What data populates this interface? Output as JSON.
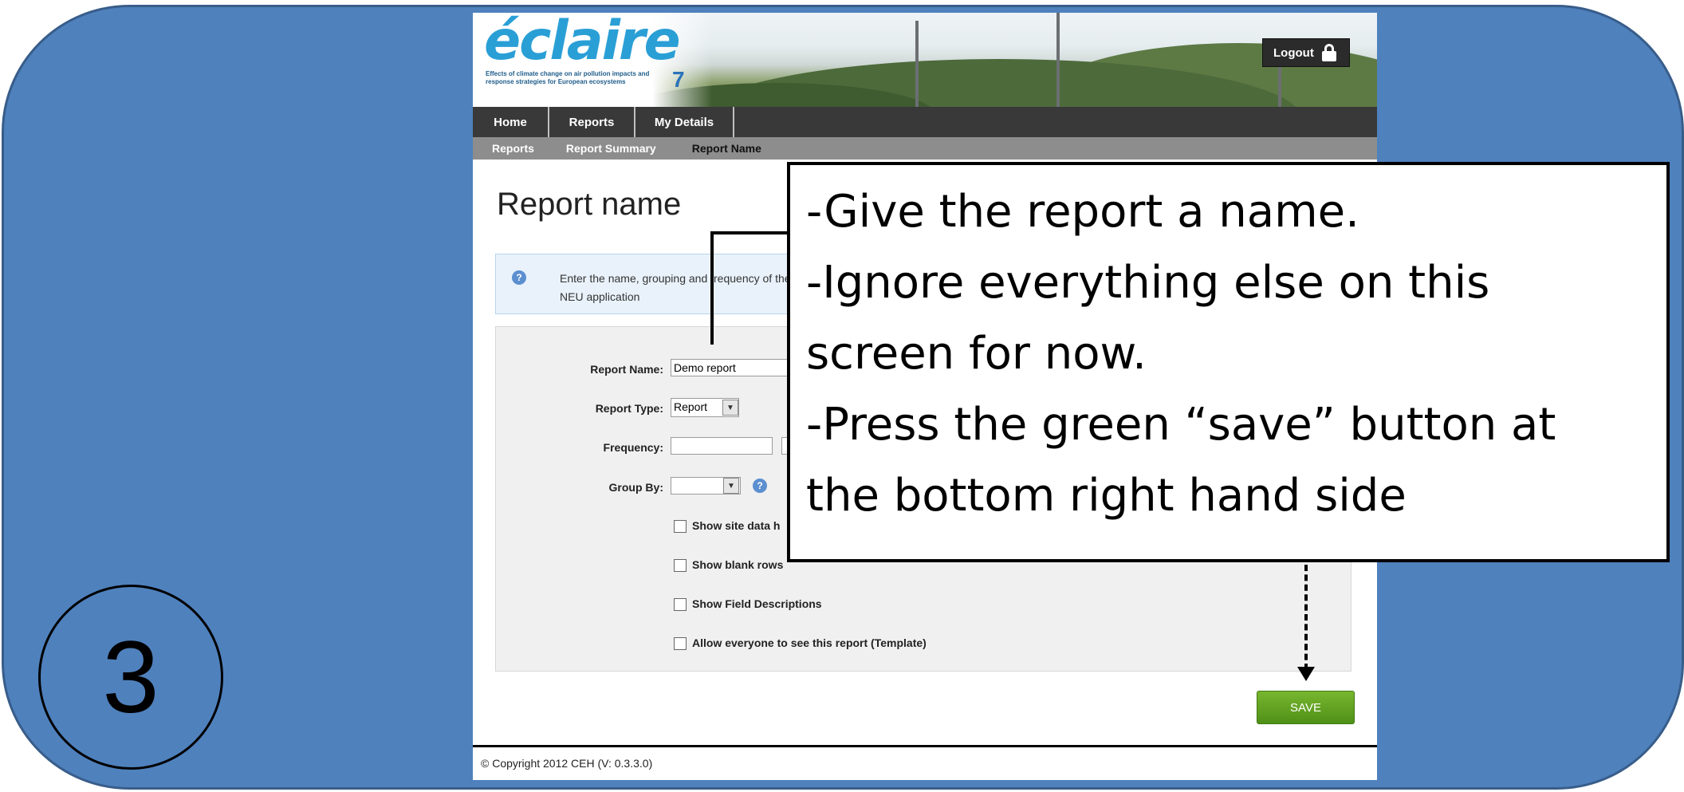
{
  "step_number": "3",
  "app": {
    "logo": "éclaire",
    "tagline": "Effects of climate change on air pollution impacts and response strategies for European ecosystems",
    "logout_label": "Logout",
    "main_nav": [
      "Home",
      "Reports",
      "My Details"
    ],
    "breadcrumb": [
      "Reports",
      "Report Summary",
      "Report Name"
    ],
    "page_title": "Report name",
    "info_text": "Enter the name, grouping and frequency of the",
    "info_text_2": "NEU application",
    "form": {
      "report_name_label": "Report Name:",
      "report_name_value": "Demo report",
      "report_type_label": "Report Type:",
      "report_type_value": "Report",
      "frequency_label": "Frequency:",
      "frequency_value": "",
      "group_by_label": "Group By:",
      "group_by_value": "",
      "checkboxes": [
        "Show site data h",
        "Show blank rows",
        "Show Field Descriptions",
        "Allow everyone to see this report (Template)"
      ]
    },
    "save_label": "SAVE",
    "footer": "© Copyright 2012 CEH  (V: 0.3.3.0)"
  },
  "callout": {
    "lines": [
      "-Give the report a name.",
      "-Ignore everything else on this",
      "screen for now.",
      "-Press the green “save” button at",
      "the bottom right hand side"
    ]
  },
  "colors": {
    "slide_background": "#4f81bd",
    "save_button": "#5fa021",
    "info_background": "#e9f2fb"
  }
}
